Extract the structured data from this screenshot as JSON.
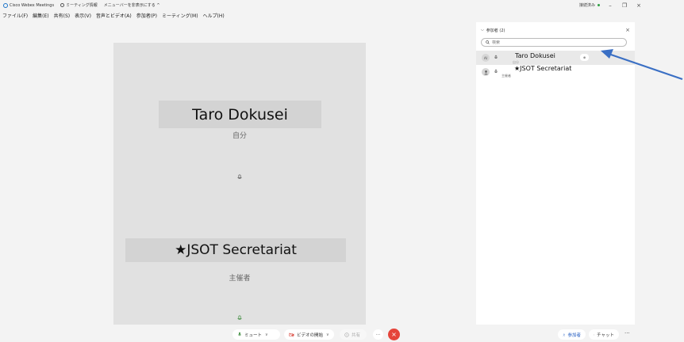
{
  "titlebar": {
    "app_title": "Cisco Webex Meetings",
    "meeting_info": "ミーティング情報",
    "hide_menu": "メニューバーを非表示にする ^",
    "status": "接続済み",
    "minimize": "–",
    "restore": "❐",
    "close": "×"
  },
  "menubar": {
    "items": [
      "ファイル(F)",
      "編集(E)",
      "共有(S)",
      "表示(V)",
      "音声とビデオ(A)",
      "参加者(P)",
      "ミーティング(M)",
      "ヘルプ(H)"
    ]
  },
  "stage": {
    "tiles": [
      {
        "name": "Taro Dokusei",
        "label": "自分"
      },
      {
        "name": "★JSOT Secretariat",
        "label": "主催者"
      }
    ]
  },
  "participants_panel": {
    "title": "参加者 (2)",
    "close": "×",
    "search_placeholder": "検索",
    "rows": [
      {
        "avatar": "AI",
        "name": "Taro Dokusei",
        "role": "自分",
        "badge": "⊕"
      },
      {
        "avatar": "",
        "name": "★JSOT Secretariat",
        "role": "主催者"
      }
    ]
  },
  "controls": {
    "mute": "ミュート",
    "video": "ビデオの開始",
    "share": "共有",
    "more": "···",
    "end": "×",
    "participants": "参加者",
    "chat": "チャット",
    "panel_more": "···"
  },
  "colors": {
    "accent": "#1a73c9",
    "end_button": "#e5443a",
    "arrow": "#3a6fc4"
  }
}
